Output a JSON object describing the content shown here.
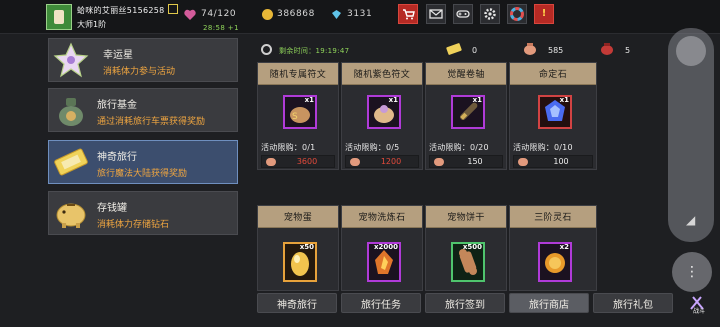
{
  "header": {
    "player_name": "蛤咪的艾丽丝5156258",
    "rank": "大师1阶",
    "stamina": "74/120",
    "stamina_timer": "28:58 +1",
    "gold": "386868",
    "gems": "3131",
    "icons": [
      "shop-cart-icon",
      "mail-icon",
      "gamepad-icon",
      "settings-gear-icon",
      "color-wheel-icon",
      "alert-icon"
    ]
  },
  "sidebar": {
    "items": [
      {
        "title": "幸运星",
        "subtitle": "消耗体力参与活动",
        "icon": "lucky-star-icon"
      },
      {
        "title": "旅行基金",
        "subtitle": "通过消耗旅行车票获得奖励",
        "icon": "money-bag-icon"
      },
      {
        "title": "神奇旅行",
        "subtitle": "旅行魔法大陆获得奖励",
        "icon": "travel-ticket-icon",
        "active": true
      },
      {
        "title": "存钱罐",
        "subtitle": "消耗体力存储钻石",
        "icon": "piggy-bank-icon"
      }
    ]
  },
  "main": {
    "remaining_time": "剩余时间：19:19:47",
    "resources": [
      {
        "value": "0",
        "icon": "ticket-icon"
      },
      {
        "value": "585",
        "icon": "pouch-icon"
      },
      {
        "value": "5",
        "icon": "red-pouch-icon"
      }
    ],
    "cards": [
      {
        "title": "随机专属符文",
        "count": "x1",
        "limit": "活动限购：0/1",
        "price": "3600",
        "price_red": true,
        "icon": "rune-bundle-icon",
        "frame": "purple"
      },
      {
        "title": "随机紫色符文",
        "count": "x1",
        "limit": "活动限购：0/5",
        "price": "1200",
        "price_red": true,
        "icon": "rune-bundle-icon",
        "frame": "purple"
      },
      {
        "title": "觉醒卷轴",
        "count": "x1",
        "limit": "活动限购：0/20",
        "price": "150",
        "price_red": false,
        "icon": "scroll-icon",
        "frame": "purple"
      },
      {
        "title": "命定石",
        "count": "x1",
        "limit": "活动限购：0/10",
        "price": "100",
        "price_red": false,
        "icon": "fate-stone-icon",
        "frame": "red"
      },
      {
        "title": "宠物蛋",
        "count": "x50",
        "icon": "pet-egg-icon",
        "frame": "orange"
      },
      {
        "title": "宠物洗炼石",
        "count": "x2000",
        "icon": "refine-stone-icon",
        "frame": "purple"
      },
      {
        "title": "宠物饼干",
        "count": "x500",
        "icon": "pet-biscuit-icon",
        "frame": "green"
      },
      {
        "title": "三阶灵石",
        "count": "x2",
        "icon": "spirit-stone-icon",
        "frame": "purple"
      }
    ],
    "tabs": [
      "神奇旅行",
      "旅行任务",
      "旅行签到",
      "旅行商店",
      "旅行礼包"
    ],
    "active_tab": "旅行商店"
  },
  "overlay": {
    "battle_label": "战斗"
  }
}
